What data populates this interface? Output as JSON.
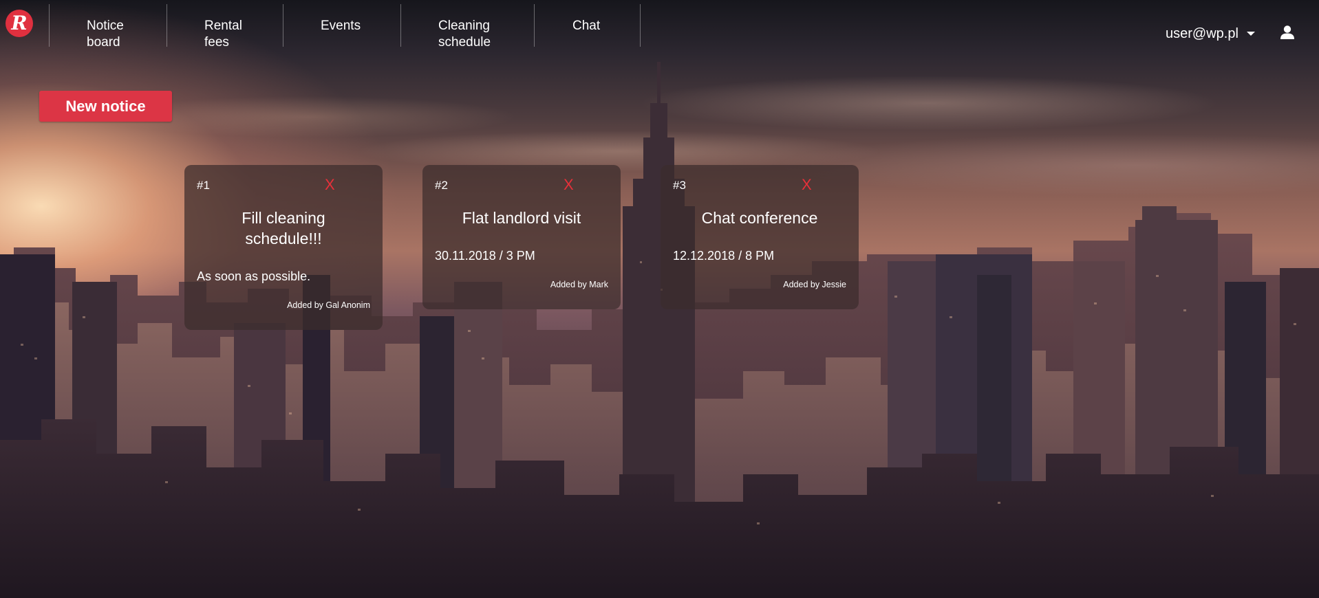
{
  "nav": {
    "logo_letter": "R",
    "items": [
      {
        "label_line1": "Notice",
        "label_line2": "board"
      },
      {
        "label_line1": "Rental",
        "label_line2": "fees"
      },
      {
        "label_line1": "Events",
        "label_line2": ""
      },
      {
        "label_line1": "Cleaning",
        "label_line2": "schedule"
      },
      {
        "label_line1": "Chat",
        "label_line2": ""
      }
    ],
    "user_email": "user@wp.pl",
    "user_icon": "user-icon",
    "caret_icon": "caret-down-icon"
  },
  "toolbar": {
    "new_notice_label": "New notice"
  },
  "colors": {
    "accent": "#dc3545",
    "close": "#e8303a",
    "card_bg": "rgba(60,45,45,0.72)"
  },
  "notices": [
    {
      "number": "#1",
      "close_label": "X",
      "title_line1": "Fill cleaning",
      "title_line2": "schedule!!!",
      "body": "As soon as possible.",
      "author": "Added by Gal Anonim"
    },
    {
      "number": "#2",
      "close_label": "X",
      "title_line1": "Flat landlord visit",
      "title_line2": "",
      "body": "30.11.2018 / 3 PM",
      "author": "Added by Mark"
    },
    {
      "number": "#3",
      "close_label": "X",
      "title_line1": "Chat conference",
      "title_line2": "",
      "body": "12.12.2018 / 8 PM",
      "author": "Added by Jessie"
    }
  ]
}
